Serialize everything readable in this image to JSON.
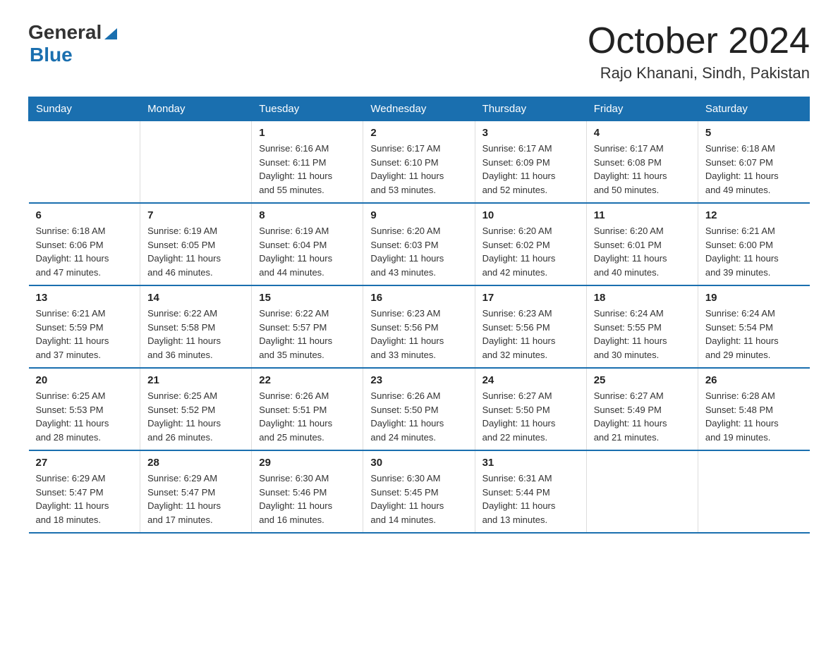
{
  "logo": {
    "general": "General",
    "blue": "Blue"
  },
  "title": "October 2024",
  "location": "Rajo Khanani, Sindh, Pakistan",
  "days_of_week": [
    "Sunday",
    "Monday",
    "Tuesday",
    "Wednesday",
    "Thursday",
    "Friday",
    "Saturday"
  ],
  "weeks": [
    [
      {
        "day": "",
        "info": ""
      },
      {
        "day": "",
        "info": ""
      },
      {
        "day": "1",
        "info": "Sunrise: 6:16 AM\nSunset: 6:11 PM\nDaylight: 11 hours\nand 55 minutes."
      },
      {
        "day": "2",
        "info": "Sunrise: 6:17 AM\nSunset: 6:10 PM\nDaylight: 11 hours\nand 53 minutes."
      },
      {
        "day": "3",
        "info": "Sunrise: 6:17 AM\nSunset: 6:09 PM\nDaylight: 11 hours\nand 52 minutes."
      },
      {
        "day": "4",
        "info": "Sunrise: 6:17 AM\nSunset: 6:08 PM\nDaylight: 11 hours\nand 50 minutes."
      },
      {
        "day": "5",
        "info": "Sunrise: 6:18 AM\nSunset: 6:07 PM\nDaylight: 11 hours\nand 49 minutes."
      }
    ],
    [
      {
        "day": "6",
        "info": "Sunrise: 6:18 AM\nSunset: 6:06 PM\nDaylight: 11 hours\nand 47 minutes."
      },
      {
        "day": "7",
        "info": "Sunrise: 6:19 AM\nSunset: 6:05 PM\nDaylight: 11 hours\nand 46 minutes."
      },
      {
        "day": "8",
        "info": "Sunrise: 6:19 AM\nSunset: 6:04 PM\nDaylight: 11 hours\nand 44 minutes."
      },
      {
        "day": "9",
        "info": "Sunrise: 6:20 AM\nSunset: 6:03 PM\nDaylight: 11 hours\nand 43 minutes."
      },
      {
        "day": "10",
        "info": "Sunrise: 6:20 AM\nSunset: 6:02 PM\nDaylight: 11 hours\nand 42 minutes."
      },
      {
        "day": "11",
        "info": "Sunrise: 6:20 AM\nSunset: 6:01 PM\nDaylight: 11 hours\nand 40 minutes."
      },
      {
        "day": "12",
        "info": "Sunrise: 6:21 AM\nSunset: 6:00 PM\nDaylight: 11 hours\nand 39 minutes."
      }
    ],
    [
      {
        "day": "13",
        "info": "Sunrise: 6:21 AM\nSunset: 5:59 PM\nDaylight: 11 hours\nand 37 minutes."
      },
      {
        "day": "14",
        "info": "Sunrise: 6:22 AM\nSunset: 5:58 PM\nDaylight: 11 hours\nand 36 minutes."
      },
      {
        "day": "15",
        "info": "Sunrise: 6:22 AM\nSunset: 5:57 PM\nDaylight: 11 hours\nand 35 minutes."
      },
      {
        "day": "16",
        "info": "Sunrise: 6:23 AM\nSunset: 5:56 PM\nDaylight: 11 hours\nand 33 minutes."
      },
      {
        "day": "17",
        "info": "Sunrise: 6:23 AM\nSunset: 5:56 PM\nDaylight: 11 hours\nand 32 minutes."
      },
      {
        "day": "18",
        "info": "Sunrise: 6:24 AM\nSunset: 5:55 PM\nDaylight: 11 hours\nand 30 minutes."
      },
      {
        "day": "19",
        "info": "Sunrise: 6:24 AM\nSunset: 5:54 PM\nDaylight: 11 hours\nand 29 minutes."
      }
    ],
    [
      {
        "day": "20",
        "info": "Sunrise: 6:25 AM\nSunset: 5:53 PM\nDaylight: 11 hours\nand 28 minutes."
      },
      {
        "day": "21",
        "info": "Sunrise: 6:25 AM\nSunset: 5:52 PM\nDaylight: 11 hours\nand 26 minutes."
      },
      {
        "day": "22",
        "info": "Sunrise: 6:26 AM\nSunset: 5:51 PM\nDaylight: 11 hours\nand 25 minutes."
      },
      {
        "day": "23",
        "info": "Sunrise: 6:26 AM\nSunset: 5:50 PM\nDaylight: 11 hours\nand 24 minutes."
      },
      {
        "day": "24",
        "info": "Sunrise: 6:27 AM\nSunset: 5:50 PM\nDaylight: 11 hours\nand 22 minutes."
      },
      {
        "day": "25",
        "info": "Sunrise: 6:27 AM\nSunset: 5:49 PM\nDaylight: 11 hours\nand 21 minutes."
      },
      {
        "day": "26",
        "info": "Sunrise: 6:28 AM\nSunset: 5:48 PM\nDaylight: 11 hours\nand 19 minutes."
      }
    ],
    [
      {
        "day": "27",
        "info": "Sunrise: 6:29 AM\nSunset: 5:47 PM\nDaylight: 11 hours\nand 18 minutes."
      },
      {
        "day": "28",
        "info": "Sunrise: 6:29 AM\nSunset: 5:47 PM\nDaylight: 11 hours\nand 17 minutes."
      },
      {
        "day": "29",
        "info": "Sunrise: 6:30 AM\nSunset: 5:46 PM\nDaylight: 11 hours\nand 16 minutes."
      },
      {
        "day": "30",
        "info": "Sunrise: 6:30 AM\nSunset: 5:45 PM\nDaylight: 11 hours\nand 14 minutes."
      },
      {
        "day": "31",
        "info": "Sunrise: 6:31 AM\nSunset: 5:44 PM\nDaylight: 11 hours\nand 13 minutes."
      },
      {
        "day": "",
        "info": ""
      },
      {
        "day": "",
        "info": ""
      }
    ]
  ]
}
